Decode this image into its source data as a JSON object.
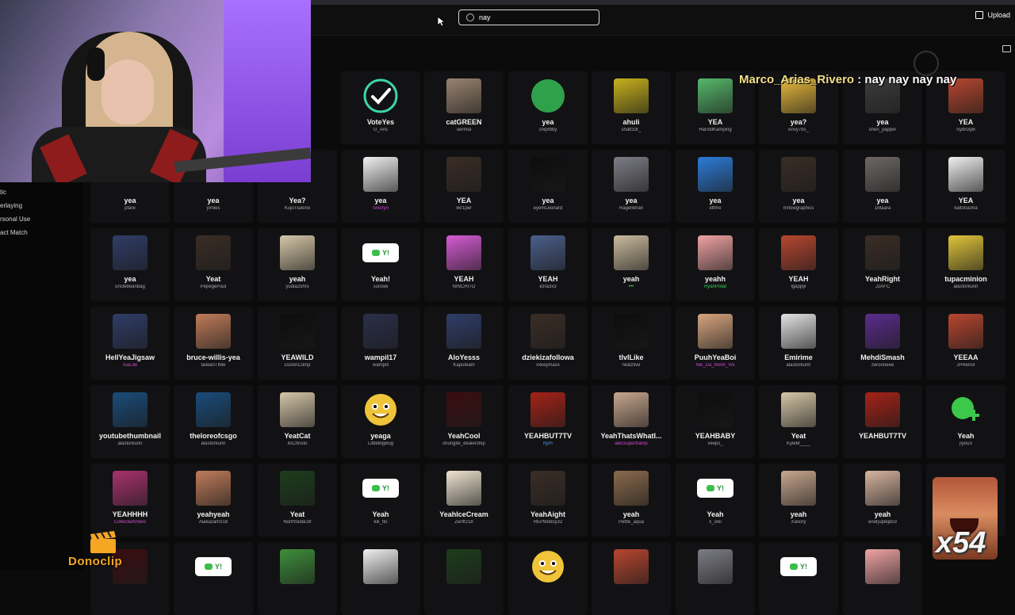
{
  "search": {
    "value": "nay"
  },
  "header": {
    "upload_label": "Upload"
  },
  "sidebar": {
    "items": [
      "tic",
      "erlaying",
      "rsonal Use",
      "act Match"
    ]
  },
  "chat_overlay": {
    "user": "Marco_Arias_Rivero",
    "message": " : nay nay nay nay"
  },
  "overlays": {
    "donoclip": "Donoclip",
    "multiplier": "x54"
  },
  "emotes": [
    {
      "name": "VoteYes",
      "user": "G_Ans",
      "thumb": "check-icon"
    },
    {
      "name": "catGREEN",
      "user": "uermia",
      "thumb": "cat"
    },
    {
      "name": "yea",
      "user": "sniprbby",
      "thumb": "yea-circle"
    },
    {
      "name": "ahuli",
      "user": "shatt33r_",
      "thumb": "blob"
    },
    {
      "name": "YEA",
      "user": "HaroldKamping",
      "thumb": "frog"
    },
    {
      "name": "yea?",
      "user": "envy7ds_",
      "thumb": "thinking"
    },
    {
      "name": "yea",
      "user": "shen_yapper",
      "thumb": "cat-dark"
    },
    {
      "name": "YEA",
      "user": "Sydn3yB",
      "thumb": "wrestler"
    },
    {
      "name": "yea",
      "user": "ptare",
      "thumb": ""
    },
    {
      "name": "yea",
      "user": "yimles",
      "thumb": ""
    },
    {
      "name": "Yea?",
      "user": "KujoTsukino",
      "thumb": ""
    },
    {
      "name": "yea",
      "user": "Sivoryn",
      "thumb": "drawn-face",
      "uc": "colored"
    },
    {
      "name": "YEA",
      "user": "xkr1per",
      "thumb": "man-dark"
    },
    {
      "name": "yea",
      "user": "eyemLeonard",
      "thumb": "text-green"
    },
    {
      "name": "yea",
      "user": "RagerBrian",
      "thumb": "cat-gray"
    },
    {
      "name": "yea",
      "user": "elthre",
      "thumb": "dolphin"
    },
    {
      "name": "yea",
      "user": "mrlowgraphics",
      "thumb": "man-dark"
    },
    {
      "name": "yea",
      "user": "1Maara",
      "thumb": "statue"
    },
    {
      "name": "YEA",
      "user": "kaltofuuma",
      "thumb": "drawn-face"
    },
    {
      "name": "yea",
      "user": "unclebeanbag",
      "thumb": "man-blue"
    },
    {
      "name": "Yeat",
      "user": "PepegePaul",
      "thumb": "man-dark"
    },
    {
      "name": "yeah",
      "user": "yudia25hrs",
      "thumb": "cat-light"
    },
    {
      "name": "Yeah!",
      "user": "sunowi",
      "thumb": "yeah-badge"
    },
    {
      "name": "YEAH",
      "user": "NINCHITO",
      "thumb": "cartoon"
    },
    {
      "name": "YEAH",
      "user": "ezra3x3",
      "thumb": "crowd"
    },
    {
      "name": "yeah",
      "user": "•••",
      "thumb": "sand",
      "uc": "green"
    },
    {
      "name": "yeahh",
      "user": "RyanPotat",
      "thumb": "anime",
      "uc": "green"
    },
    {
      "name": "YEAH",
      "user": "lgappyl",
      "thumb": "wrestler"
    },
    {
      "name": "YeahRight",
      "user": "J2AFC",
      "thumb": "man-dark"
    },
    {
      "name": "tupacminion",
      "user": "alastorkunn",
      "thumb": "minion"
    },
    {
      "name": "HellYeaJigsaw",
      "user": "IsacJB",
      "thumb": "man-blue",
      "uc": "colored"
    },
    {
      "name": "bruce-willis-yea",
      "user": "taiwanTIMe",
      "thumb": "bald"
    },
    {
      "name": "YEAWILD",
      "user": "DustinComp",
      "thumb": "wild"
    },
    {
      "name": "wampil17",
      "user": "wampill",
      "thumb": "stage"
    },
    {
      "name": "AloYesss",
      "user": "Kaputeam",
      "thumb": "man-blue"
    },
    {
      "name": "dziekizafollowa",
      "user": "xxkeymaxx",
      "thumb": "man-dark"
    },
    {
      "name": "tlvlLike",
      "user": "nilatzlive",
      "thumb": "like"
    },
    {
      "name": "PuuhYeaBoi",
      "user": "Nik_Da_INAR_Vik",
      "thumb": "woman",
      "uc": "colored"
    },
    {
      "name": "Emirime",
      "user": "alastorkunn",
      "thumb": "blob-face"
    },
    {
      "name": "MehdiSmash",
      "user": "zerooneee",
      "thumb": "purple"
    },
    {
      "name": "YEEAA",
      "user": "JPRenor",
      "thumb": "wrestler"
    },
    {
      "name": "youtubethumbnail",
      "user": "alastorkunn",
      "thumb": "thumb"
    },
    {
      "name": "theloreofcsgo",
      "user": "alastorkunn",
      "thumb": "thumb"
    },
    {
      "name": "YeatCat",
      "user": "itsChristo",
      "thumb": "cat-light"
    },
    {
      "name": "yeaga",
      "user": "LittleBigBug",
      "thumb": "smiley"
    },
    {
      "name": "YeahCool",
      "user": "shungite_dealership",
      "thumb": "red-dark"
    },
    {
      "name": "YEAHBUT7TV",
      "user": "hyrn",
      "thumb": "man-red",
      "uc": "blue"
    },
    {
      "name": "YeahThatsWhatI...",
      "user": "alecsupertramp",
      "thumb": "man-light",
      "uc": "colored"
    },
    {
      "name": "YEAHBABY",
      "user": "veeps_",
      "thumb": "singer"
    },
    {
      "name": "Yeat",
      "user": "KyleM____",
      "thumb": "cat-light"
    },
    {
      "name": "YEAHBUT7TV",
      "user": "",
      "thumb": "man-red"
    },
    {
      "name": "Yeah",
      "user": "jiyou3",
      "thumb": "green-plus"
    },
    {
      "name": "YEAHHHH",
      "user": "CollectedVideo",
      "thumb": "dancer",
      "uc": "colored"
    },
    {
      "name": "yeahyeah",
      "user": "Alakazam318",
      "thumb": "bald"
    },
    {
      "name": "Yeat",
      "user": "NorthSideLW",
      "thumb": "green-dark"
    },
    {
      "name": "Yeah",
      "user": "kili_tto",
      "thumb": "yeah-badge"
    },
    {
      "name": "YeahIceCream",
      "user": "Zeriff218",
      "thumb": "icecream"
    },
    {
      "name": "YeahAight",
      "user": "REPtileboy32",
      "thumb": "man-dark"
    },
    {
      "name": "yeah",
      "user": "Petite_aqua",
      "thumb": "sackboy"
    },
    {
      "name": "Yeah",
      "user": "x_onii",
      "thumb": "yeah-badge"
    },
    {
      "name": "yeah",
      "user": "Xanory",
      "thumb": "man-light"
    },
    {
      "name": "yeah",
      "user": "endrjuplejdo3",
      "thumb": "baby"
    },
    {
      "name": "",
      "user": "",
      "thumb": ""
    },
    {
      "name": "",
      "user": "",
      "thumb": "red-dark"
    },
    {
      "name": "",
      "user": "",
      "thumb": "yeah-badge"
    },
    {
      "name": "",
      "user": "",
      "thumb": "pepe"
    },
    {
      "name": "",
      "user": "",
      "thumb": "drawn-face"
    },
    {
      "name": "",
      "user": "",
      "thumb": "green-dark"
    },
    {
      "name": "",
      "user": "",
      "thumb": "smiley"
    },
    {
      "name": "",
      "user": "",
      "thumb": "wrestler"
    },
    {
      "name": "",
      "user": "",
      "thumb": "cat-gray"
    },
    {
      "name": "",
      "user": "",
      "thumb": "yeah-badge"
    },
    {
      "name": "",
      "user": "",
      "thumb": "anime"
    }
  ]
}
